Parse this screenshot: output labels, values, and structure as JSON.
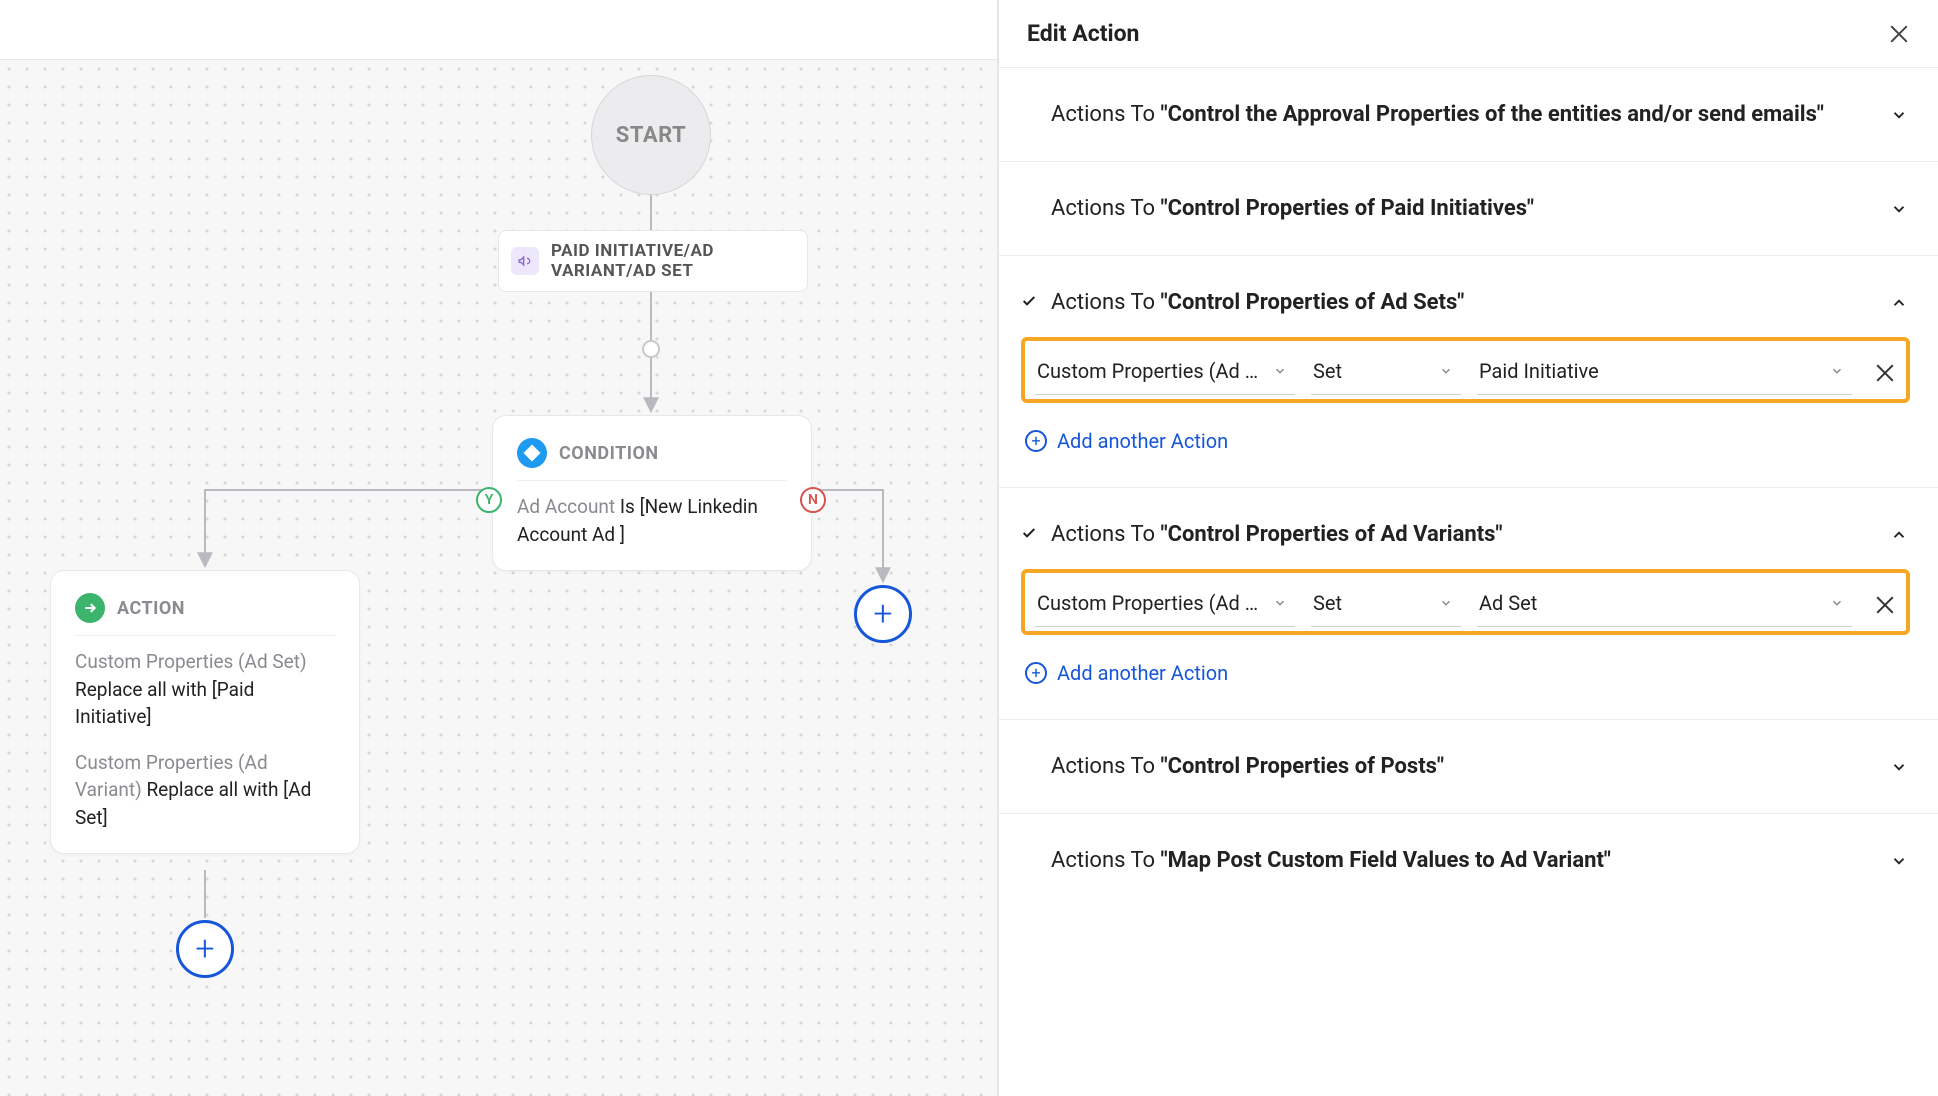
{
  "canvas": {
    "start_label": "START",
    "trigger": {
      "label": "PAID INITIATIVE/AD VARIANT/AD SET"
    },
    "yes_label": "Y",
    "no_label": "N",
    "condition": {
      "header": "CONDITION",
      "field": "Ad Account",
      "op": "Is",
      "value": "[New Linkedin Account Ad ]"
    },
    "action": {
      "header": "ACTION",
      "line1_muted": "Custom Properties (Ad Set)",
      "line1_bold": "Replace all with [Paid Initiative]",
      "line2_muted": "Custom Properties (Ad Variant)",
      "line2_bold": "Replace all with [Ad Set]"
    }
  },
  "panel": {
    "title": "Edit Action",
    "actions_to_prefix": "Actions To",
    "add_action_label": "Add another Action",
    "sections": [
      {
        "id": "approval",
        "title": "\"Control the Approval Properties of the entities and/or send emails\"",
        "expanded": false,
        "checked": false
      },
      {
        "id": "paid_init",
        "title": "\"Control Properties of Paid Initiatives\"",
        "expanded": false,
        "checked": false
      },
      {
        "id": "ad_sets",
        "title": "\"Control Properties of Ad Sets\"",
        "expanded": true,
        "checked": true,
        "row": {
          "field": "Custom Properties (Ad …",
          "op": "Set",
          "value": "Paid Initiative"
        }
      },
      {
        "id": "ad_variants",
        "title": "\"Control Properties of Ad Variants\"",
        "expanded": true,
        "checked": true,
        "row": {
          "field": "Custom Properties (Ad …",
          "op": "Set",
          "value": "Ad Set"
        }
      },
      {
        "id": "posts",
        "title": "\"Control Properties of Posts\"",
        "expanded": false,
        "checked": false
      },
      {
        "id": "map_post",
        "title": "\"Map Post Custom Field Values to Ad Variant\"",
        "expanded": false,
        "checked": false
      }
    ]
  }
}
